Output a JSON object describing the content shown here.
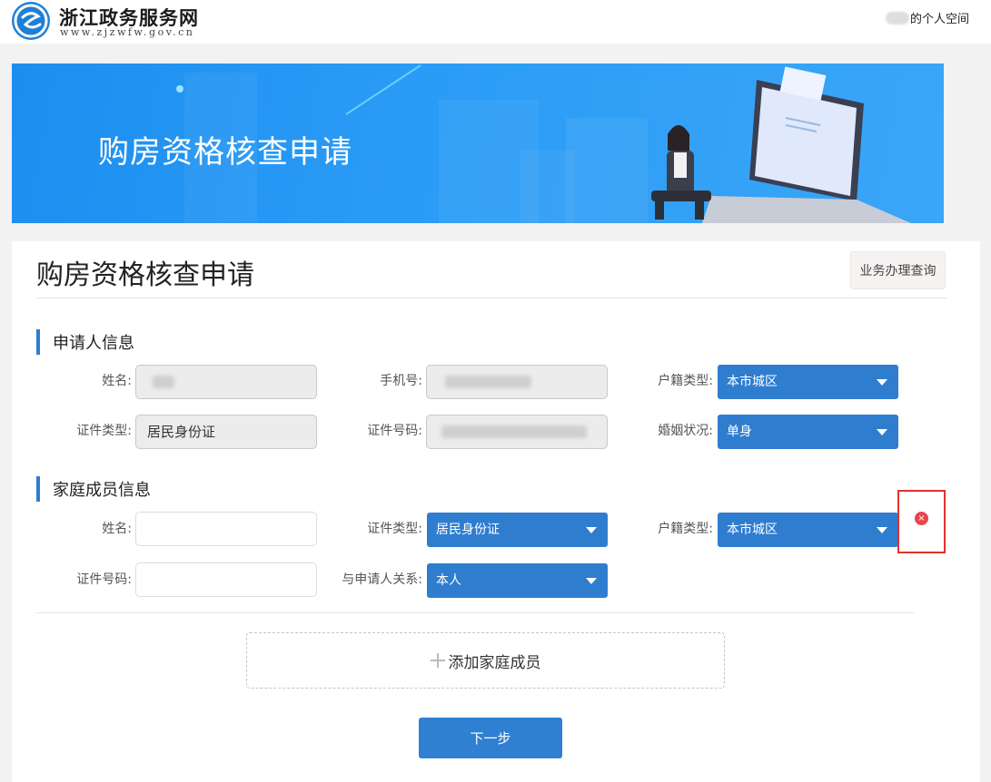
{
  "header": {
    "site_name": "浙江政务服务网",
    "site_url": "www.zjzwfw.gov.cn",
    "user_space": "的个人空间"
  },
  "banner": {
    "title": "购房资格核查申请"
  },
  "page": {
    "title": "购房资格核查申请",
    "query_button": "业务办理查询"
  },
  "applicant": {
    "section_title": "申请人信息",
    "name_label": "姓名:",
    "phone_label": "手机号:",
    "hukou_label": "户籍类型:",
    "hukou_value": "本市城区",
    "id_type_label": "证件类型:",
    "id_type_value": "居民身份证",
    "id_number_label": "证件号码:",
    "marital_label": "婚姻状况:",
    "marital_value": "单身"
  },
  "family": {
    "section_title": "家庭成员信息",
    "name_label": "姓名:",
    "name_value": "",
    "id_type_label": "证件类型:",
    "id_type_value": "居民身份证",
    "hukou_label": "户籍类型:",
    "hukou_value": "本市城区",
    "id_number_label": "证件号码:",
    "id_number_value": "",
    "relation_label": "与申请人关系:",
    "relation_value": "本人",
    "remove_icon": "×"
  },
  "actions": {
    "add_member": "添加家庭成员",
    "next": "下一步"
  },
  "colors": {
    "primary": "#2f7dcf",
    "banner": "#2b9cf6",
    "danger": "#e0322e"
  }
}
